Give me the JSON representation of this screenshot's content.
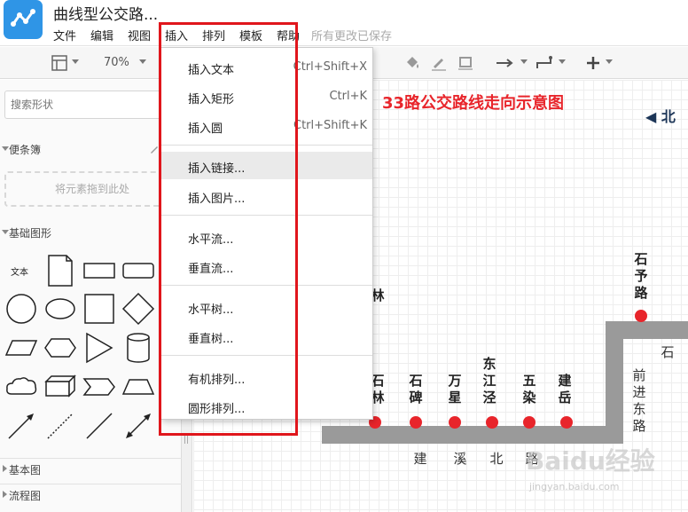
{
  "app": {
    "title": "曲线型公交路...",
    "logo_icon": "share-nodes-icon",
    "save_status": "所有更改已保存"
  },
  "menubar": [
    "文件",
    "编辑",
    "视图",
    "插入",
    "排列",
    "模板",
    "帮助"
  ],
  "toolbar": {
    "zoom": "70%"
  },
  "insert_menu": {
    "groups": [
      [
        {
          "label": "插入文本",
          "shortcut": "Ctrl+Shift+X"
        },
        {
          "label": "插入矩形",
          "shortcut": "Ctrl+K"
        },
        {
          "label": "插入圆",
          "shortcut": "Ctrl+Shift+K"
        }
      ],
      [
        {
          "label": "插入链接...",
          "shortcut": ""
        },
        {
          "label": "插入图片...",
          "shortcut": ""
        }
      ],
      [
        {
          "label": "水平流...",
          "shortcut": ""
        },
        {
          "label": "垂直流...",
          "shortcut": ""
        }
      ],
      [
        {
          "label": "水平树...",
          "shortcut": ""
        },
        {
          "label": "垂直树...",
          "shortcut": ""
        }
      ],
      [
        {
          "label": "有机排列...",
          "shortcut": ""
        },
        {
          "label": "圆形排列...",
          "shortcut": ""
        }
      ]
    ]
  },
  "sidebar": {
    "search_placeholder": "搜索形状",
    "scratchpad": {
      "title": "便条簿",
      "drop_hint": "将元素拖到此处"
    },
    "basic_shapes": {
      "title": "基础图形",
      "text_shape_label": "文本"
    },
    "collapsed_sections": [
      "基本图",
      "流程图"
    ]
  },
  "canvas": {
    "map_title": "33路公交路线走向示意图",
    "north_label": "◀ 北",
    "stops": [
      "石碑",
      "万星",
      "东江泾",
      "五染",
      "建岳",
      "石予路"
    ],
    "partial_stops": [
      "林",
      "石林"
    ],
    "roads": {
      "bottom": [
        "建",
        "溪",
        "北",
        "路"
      ],
      "right": "前进东路",
      "right_top": "石"
    },
    "route_color": "#9a9a9a",
    "stop_color": "#e8252b",
    "watermark": "Baidu经验",
    "watermark_url": "jingyan.baidu.com"
  }
}
